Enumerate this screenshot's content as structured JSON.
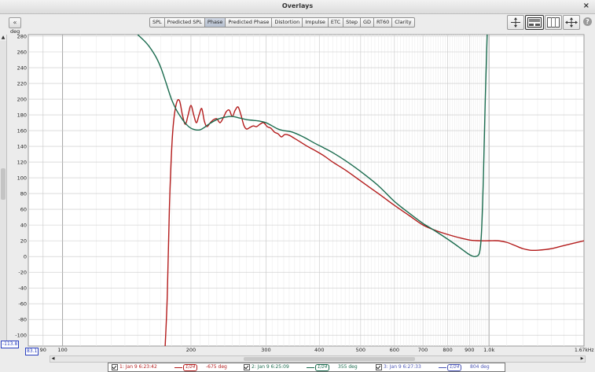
{
  "window": {
    "title": "Overlays",
    "close_label": "×"
  },
  "toolbar": {
    "collapse_label": "«",
    "tabs": [
      {
        "label": "SPL",
        "active": false
      },
      {
        "label": "Predicted SPL",
        "active": false
      },
      {
        "label": "Phase",
        "active": true
      },
      {
        "label": "Predicted Phase",
        "active": false
      },
      {
        "label": "Distortion",
        "active": false
      },
      {
        "label": "Impulse",
        "active": false
      },
      {
        "label": "ETC",
        "active": false
      },
      {
        "label": "Step",
        "active": false
      },
      {
        "label": "GD",
        "active": false
      },
      {
        "label": "RT60",
        "active": false
      },
      {
        "label": "Clarity",
        "active": false
      }
    ],
    "buttons": [
      "zoom-vertical-icon",
      "controls-panel-icon",
      "grid-icon",
      "zoom-all-icon"
    ],
    "help_label": "?"
  },
  "plot": {
    "y_unit": "deg",
    "y_min_readout": "-113.8",
    "x_min_readout": "83.1",
    "x_unit": "1.67kHz",
    "grid_color": "#c8c8c8",
    "background": "#ffffff"
  },
  "chart_data": {
    "type": "line",
    "xscale": "log",
    "xlim": [
      83.1,
      1670
    ],
    "ylim": [
      -113.8,
      282
    ],
    "ylabel": "deg",
    "xticks": [
      {
        "value": 90,
        "label": "90",
        "major": false
      },
      {
        "value": 100,
        "label": "100",
        "major": true
      },
      {
        "value": 200,
        "label": "200",
        "major": false
      },
      {
        "value": 300,
        "label": "300",
        "major": false
      },
      {
        "value": 400,
        "label": "400",
        "major": false
      },
      {
        "value": 500,
        "label": "500",
        "major": false
      },
      {
        "value": 600,
        "label": "600",
        "major": false
      },
      {
        "value": 700,
        "label": "700",
        "major": false
      },
      {
        "value": 800,
        "label": "800",
        "major": false
      },
      {
        "value": 900,
        "label": "900",
        "major": false
      },
      {
        "value": 1000,
        "label": "1.0k",
        "major": true
      }
    ],
    "yticks": [
      280,
      260,
      240,
      220,
      200,
      180,
      160,
      140,
      120,
      100,
      80,
      60,
      40,
      20,
      0,
      -20,
      -40,
      -60,
      -80,
      -100
    ],
    "series": [
      {
        "color": "#b31b1b",
        "points": [
          [
            174,
            -114
          ],
          [
            176,
            -50
          ],
          [
            178,
            60
          ],
          [
            180,
            130
          ],
          [
            182,
            170
          ],
          [
            185,
            195
          ],
          [
            188,
            198
          ],
          [
            191,
            180
          ],
          [
            194,
            168
          ],
          [
            197,
            180
          ],
          [
            200,
            192
          ],
          [
            203,
            180
          ],
          [
            206,
            170
          ],
          [
            209,
            180
          ],
          [
            212,
            188
          ],
          [
            215,
            172
          ],
          [
            218,
            165
          ],
          [
            222,
            170
          ],
          [
            226,
            174
          ],
          [
            230,
            175
          ],
          [
            234,
            170
          ],
          [
            238,
            176
          ],
          [
            242,
            184
          ],
          [
            246,
            186
          ],
          [
            250,
            178
          ],
          [
            254,
            186
          ],
          [
            258,
            190
          ],
          [
            262,
            180
          ],
          [
            266,
            167
          ],
          [
            270,
            162
          ],
          [
            275,
            164
          ],
          [
            280,
            166
          ],
          [
            285,
            165
          ],
          [
            290,
            168
          ],
          [
            296,
            170
          ],
          [
            302,
            165
          ],
          [
            308,
            163
          ],
          [
            314,
            158
          ],
          [
            320,
            156
          ],
          [
            326,
            152
          ],
          [
            332,
            155
          ],
          [
            340,
            154
          ],
          [
            350,
            150
          ],
          [
            360,
            146
          ],
          [
            375,
            140
          ],
          [
            390,
            135
          ],
          [
            410,
            128
          ],
          [
            430,
            120
          ],
          [
            460,
            110
          ],
          [
            500,
            96
          ],
          [
            550,
            80
          ],
          [
            600,
            65
          ],
          [
            650,
            52
          ],
          [
            700,
            40
          ],
          [
            750,
            33
          ],
          [
            800,
            28
          ],
          [
            850,
            24
          ],
          [
            900,
            21
          ],
          [
            950,
            20
          ],
          [
            1000,
            20
          ],
          [
            1050,
            20
          ],
          [
            1100,
            18
          ],
          [
            1150,
            14
          ],
          [
            1200,
            10
          ],
          [
            1250,
            8
          ],
          [
            1300,
            8
          ],
          [
            1400,
            10
          ],
          [
            1500,
            14
          ],
          [
            1670,
            20
          ]
        ]
      },
      {
        "color": "#1a6b4e",
        "points": [
          [
            150,
            282
          ],
          [
            158,
            270
          ],
          [
            165,
            255
          ],
          [
            170,
            240
          ],
          [
            175,
            220
          ],
          [
            180,
            200
          ],
          [
            185,
            186
          ],
          [
            190,
            176
          ],
          [
            195,
            168
          ],
          [
            200,
            163
          ],
          [
            205,
            161
          ],
          [
            210,
            161
          ],
          [
            215,
            164
          ],
          [
            220,
            168
          ],
          [
            230,
            174
          ],
          [
            240,
            177
          ],
          [
            250,
            178
          ],
          [
            260,
            176
          ],
          [
            270,
            174
          ],
          [
            280,
            173
          ],
          [
            290,
            172
          ],
          [
            300,
            170
          ],
          [
            310,
            166
          ],
          [
            320,
            162
          ],
          [
            330,
            160
          ],
          [
            340,
            159
          ],
          [
            350,
            157
          ],
          [
            370,
            151
          ],
          [
            390,
            144
          ],
          [
            410,
            138
          ],
          [
            430,
            132
          ],
          [
            460,
            122
          ],
          [
            500,
            108
          ],
          [
            550,
            90
          ],
          [
            600,
            70
          ],
          [
            650,
            55
          ],
          [
            700,
            42
          ],
          [
            730,
            36
          ],
          [
            760,
            30
          ],
          [
            790,
            24
          ],
          [
            820,
            18
          ],
          [
            850,
            12
          ],
          [
            870,
            8
          ],
          [
            890,
            4
          ],
          [
            910,
            1
          ],
          [
            930,
            0
          ],
          [
            950,
            5
          ],
          [
            960,
            30
          ],
          [
            970,
            100
          ],
          [
            980,
            200
          ],
          [
            990,
            282
          ]
        ]
      }
    ]
  },
  "legend": [
    {
      "name": "1: Jan 9 6:23:42",
      "smoothing": "1/24",
      "delay": "-675 deg",
      "color": "#b31b1b"
    },
    {
      "name": "2: Jan 9 6:25:09",
      "smoothing": "1/24",
      "delay": "355 deg",
      "color": "#1a6b4e"
    },
    {
      "name": "3: Jan 9 6:27:33",
      "smoothing": "1/24",
      "delay": "804 deg",
      "color": "#4a55b5"
    }
  ]
}
